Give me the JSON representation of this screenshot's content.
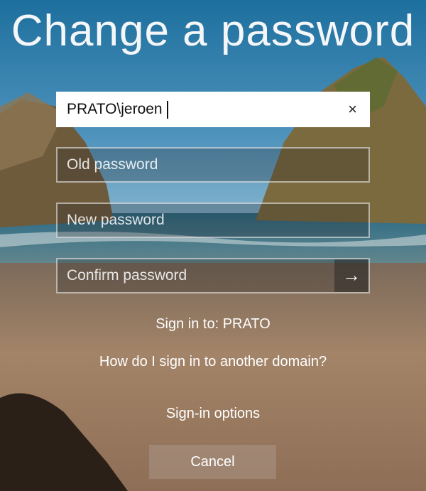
{
  "title": "Change a password",
  "fields": {
    "username": {
      "value": "PRATO\\jeroen"
    },
    "old_password": {
      "placeholder": "Old password"
    },
    "new_password": {
      "placeholder": "New password"
    },
    "confirm_password": {
      "placeholder": "Confirm password"
    }
  },
  "icons": {
    "clear": "×",
    "submit": "→"
  },
  "sign_in_to": "Sign in to: PRATO",
  "other_domain_link": "How do I sign in to another domain?",
  "sign_in_options": "Sign-in options",
  "cancel_label": "Cancel"
}
